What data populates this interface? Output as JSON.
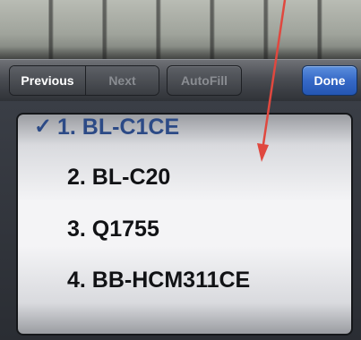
{
  "toolbar": {
    "previous_label": "Previous",
    "next_label": "Next",
    "autofill_label": "AutoFill",
    "done_label": "Done"
  },
  "picker": {
    "check_mark": "✓",
    "items": [
      {
        "label": "1. BL-C1CE",
        "selected": true
      },
      {
        "label": "2. BL-C20",
        "selected": false
      },
      {
        "label": "3. Q1755",
        "selected": false
      },
      {
        "label": "4. BB-HCM311CE",
        "selected": false
      }
    ]
  },
  "colors": {
    "done_button": "#3669c7",
    "selected_text": "#2c4a86",
    "annotation_arrow": "#e0483f"
  },
  "icons": {
    "check": "check-icon",
    "arrow": "arrow-annotation-icon"
  }
}
